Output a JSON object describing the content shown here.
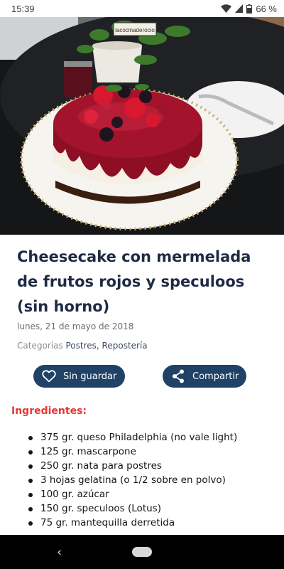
{
  "status_bar": {
    "time": "15:39",
    "battery": "66 %",
    "icons": [
      "wifi-icon",
      "signal-icon",
      "battery-icon"
    ]
  },
  "hero": {
    "image": "cheesecake-photo",
    "sign_text": "lacocinaderocio"
  },
  "recipe": {
    "title": "Cheesecake con mermelada de frutos rojos y speculoos (sin horno)",
    "date": "lunes, 21 de mayo de 2018",
    "categories_label": "Categorías",
    "category_1": "Postres",
    "separator": ", ",
    "category_2": "Repostería"
  },
  "actions": {
    "save_label": "Sin guardar",
    "share_label": "Compartir",
    "save_icon": "heart-icon",
    "share_icon": "share-icon"
  },
  "ingredients": {
    "heading": "Ingredientes:",
    "items": [
      "375 gr. queso Philadelphia (no vale light)",
      "125 gr. mascarpone",
      "250 gr. nata para postres",
      "3 hojas gelatina (o 1/2 sobre en polvo)",
      "100 gr. azúcar",
      "150 gr. speculoos (Lotus)",
      "75 gr. mantequilla derretida"
    ]
  },
  "nav_bar": {
    "back_icon": "back-icon",
    "home_icon": "home-pill-icon"
  },
  "colors": {
    "accent": "#1f4266",
    "heading_red": "#e53935",
    "title": "#1f2a44"
  }
}
